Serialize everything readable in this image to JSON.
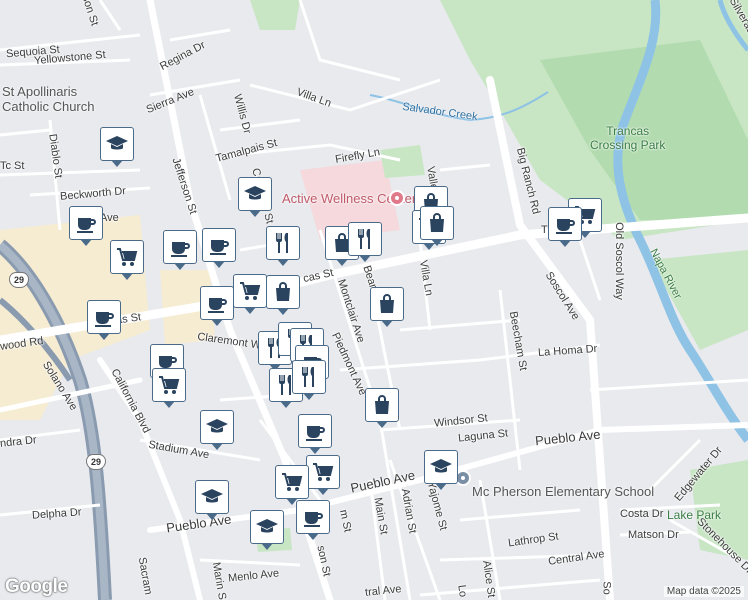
{
  "map": {
    "attribution": "Map data ©2025",
    "logo": "Google",
    "colors": {
      "park": "#c8e6c4",
      "park_dark": "#b3dbb0",
      "water": "#8ec3e6",
      "highway": "#8a9bb0",
      "road": "#ffffff",
      "land": "#e8eaee",
      "commercial": "#f6ecd2",
      "marker_border": "#4a6a8a"
    },
    "streets": [
      {
        "name": "Sequoia St"
      },
      {
        "name": "Yellowstone St"
      },
      {
        "name": "Regina Dr"
      },
      {
        "name": "Sierra Ave"
      },
      {
        "name": "Villa Ln"
      },
      {
        "name": "Willis Dr"
      },
      {
        "name": "Tamalpais St"
      },
      {
        "name": "Firefly Ln"
      },
      {
        "name": "Jefferson St"
      },
      {
        "name": "Cascade St"
      },
      {
        "name": "Diablo St"
      },
      {
        "name": "Beckworth Dr"
      },
      {
        "name": "Tc St"
      },
      {
        "name": "Ave"
      },
      {
        "name": "as St"
      },
      {
        "name": "cas St"
      },
      {
        "name": "Claremont Way"
      },
      {
        "name": "wood Rd"
      },
      {
        "name": "Montclair Ave"
      },
      {
        "name": "Beard Rd"
      },
      {
        "name": "Villa Ln"
      },
      {
        "name": "Piedmont Ave"
      },
      {
        "name": "California Blvd"
      },
      {
        "name": "Solano Ave"
      },
      {
        "name": "Beecham St"
      },
      {
        "name": "La Homa Dr"
      },
      {
        "name": "Windsor St"
      },
      {
        "name": "Laguna St"
      },
      {
        "name": "Pueblo Ave"
      },
      {
        "name": "Stadium Ave"
      },
      {
        "name": "Pueblo Ave"
      },
      {
        "name": "Pueblo Ave"
      },
      {
        "name": "ndra Dr"
      },
      {
        "name": "Delpha Dr"
      },
      {
        "name": "Main St"
      },
      {
        "name": "Adrian St"
      },
      {
        "name": "Yajome St"
      },
      {
        "name": "Menlo Ave"
      },
      {
        "name": "Marin S"
      },
      {
        "name": "Sacram"
      },
      {
        "name": "son St"
      },
      {
        "name": "m St"
      },
      {
        "name": "Lathrop St"
      },
      {
        "name": "Central Ave"
      },
      {
        "name": "Alice St"
      },
      {
        "name": "Lo"
      },
      {
        "name": "Costa Dr"
      },
      {
        "name": "Matson Dr"
      },
      {
        "name": "Edgewater Dr"
      },
      {
        "name": "Stonehouse Dr"
      },
      {
        "name": "Soscol Ave"
      },
      {
        "name": "Big Ranch Rd"
      },
      {
        "name": "Old Soscol Way"
      },
      {
        "name": "Silverad"
      },
      {
        "name": "T"
      },
      {
        "name": "erson St"
      },
      {
        "name": "Valley"
      },
      {
        "name": "tral Ave"
      },
      {
        "name": "So"
      }
    ],
    "pois": [
      {
        "name": "St Apollinaris Catholic Church",
        "line1": "St Apollinaris",
        "line2": "Catholic Church"
      },
      {
        "name": "Active Wellness Center"
      },
      {
        "name": "Mc Pherson Elementary School"
      }
    ],
    "parks": [
      {
        "line1": "Trancas",
        "line2": "Crossing Park"
      },
      {
        "line1": "Lake Park"
      }
    ],
    "water": [
      {
        "name": "Salvador Creek"
      },
      {
        "name": "Napa River"
      }
    ],
    "highways": [
      {
        "number": "29"
      },
      {
        "number": "29"
      }
    ],
    "markers": [
      {
        "icon": "school"
      },
      {
        "icon": "school"
      },
      {
        "icon": "coffee"
      },
      {
        "icon": "cart"
      },
      {
        "icon": "coffee"
      },
      {
        "icon": "coffee"
      },
      {
        "icon": "coffee"
      },
      {
        "icon": "restaurant"
      },
      {
        "icon": "bag"
      },
      {
        "icon": "restaurant"
      },
      {
        "icon": "bag"
      },
      {
        "icon": "bag"
      },
      {
        "icon": "cart"
      },
      {
        "icon": "coffee"
      },
      {
        "icon": "cart"
      },
      {
        "icon": "coffee"
      },
      {
        "icon": "cart"
      },
      {
        "icon": "bag"
      },
      {
        "icon": "coffee"
      },
      {
        "icon": "bag"
      },
      {
        "icon": "restaurant"
      },
      {
        "icon": "restaurant"
      },
      {
        "icon": "restaurant"
      },
      {
        "icon": "coffee"
      },
      {
        "icon": "cart"
      },
      {
        "icon": "restaurant"
      },
      {
        "icon": "restaurant"
      },
      {
        "icon": "bag"
      },
      {
        "icon": "school"
      },
      {
        "icon": "coffee"
      },
      {
        "icon": "cart"
      },
      {
        "icon": "cart"
      },
      {
        "icon": "school"
      },
      {
        "icon": "school"
      },
      {
        "icon": "coffee"
      },
      {
        "icon": "school"
      }
    ]
  }
}
